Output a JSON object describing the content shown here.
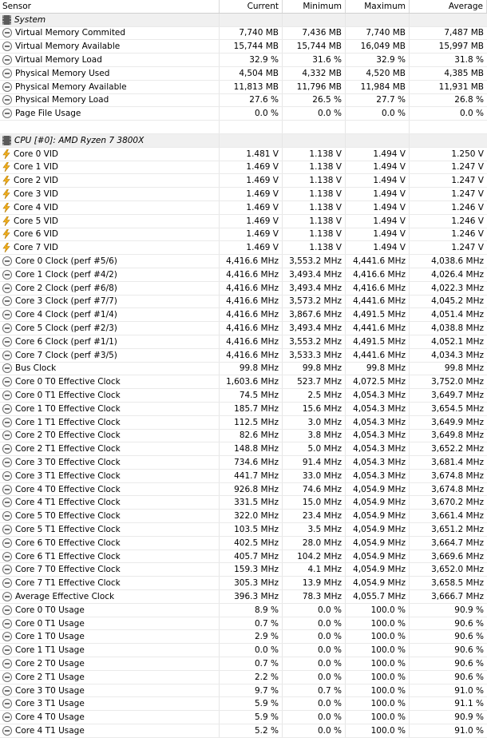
{
  "columns": {
    "sensor": "Sensor",
    "current": "Current",
    "minimum": "Minimum",
    "maximum": "Maximum",
    "average": "Average"
  },
  "rows": [
    {
      "type": "group",
      "icon": "chip-icon",
      "label": "System"
    },
    {
      "type": "sensor",
      "icon": "clock-icon",
      "label": "Virtual Memory Commited",
      "current": "7,740 MB",
      "minimum": "7,436 MB",
      "maximum": "7,740 MB",
      "average": "7,487 MB"
    },
    {
      "type": "sensor",
      "icon": "clock-icon",
      "label": "Virtual Memory Available",
      "current": "15,744 MB",
      "minimum": "15,744 MB",
      "maximum": "16,049 MB",
      "average": "15,997 MB"
    },
    {
      "type": "sensor",
      "icon": "clock-icon",
      "label": "Virtual Memory Load",
      "current": "32.9 %",
      "minimum": "31.6 %",
      "maximum": "32.9 %",
      "average": "31.8 %"
    },
    {
      "type": "sensor",
      "icon": "clock-icon",
      "label": "Physical Memory Used",
      "current": "4,504 MB",
      "minimum": "4,332 MB",
      "maximum": "4,520 MB",
      "average": "4,385 MB"
    },
    {
      "type": "sensor",
      "icon": "clock-icon",
      "label": "Physical Memory Available",
      "current": "11,813 MB",
      "minimum": "11,796 MB",
      "maximum": "11,984 MB",
      "average": "11,931 MB"
    },
    {
      "type": "sensor",
      "icon": "clock-icon",
      "label": "Physical Memory Load",
      "current": "27.6 %",
      "minimum": "26.5 %",
      "maximum": "27.7 %",
      "average": "26.8 %"
    },
    {
      "type": "sensor",
      "icon": "clock-icon",
      "label": "Page File Usage",
      "current": "0.0 %",
      "minimum": "0.0 %",
      "maximum": "0.0 %",
      "average": "0.0 %"
    },
    {
      "type": "blank"
    },
    {
      "type": "group",
      "icon": "chip-icon",
      "label": "CPU [#0]: AMD Ryzen 7 3800X"
    },
    {
      "type": "sensor",
      "icon": "voltage-icon",
      "label": "Core 0 VID",
      "current": "1.481 V",
      "minimum": "1.138 V",
      "maximum": "1.494 V",
      "average": "1.250 V"
    },
    {
      "type": "sensor",
      "icon": "voltage-icon",
      "label": "Core 1 VID",
      "current": "1.469 V",
      "minimum": "1.138 V",
      "maximum": "1.494 V",
      "average": "1.247 V"
    },
    {
      "type": "sensor",
      "icon": "voltage-icon",
      "label": "Core 2 VID",
      "current": "1.469 V",
      "minimum": "1.138 V",
      "maximum": "1.494 V",
      "average": "1.247 V"
    },
    {
      "type": "sensor",
      "icon": "voltage-icon",
      "label": "Core 3 VID",
      "current": "1.469 V",
      "minimum": "1.138 V",
      "maximum": "1.494 V",
      "average": "1.247 V"
    },
    {
      "type": "sensor",
      "icon": "voltage-icon",
      "label": "Core 4 VID",
      "current": "1.469 V",
      "minimum": "1.138 V",
      "maximum": "1.494 V",
      "average": "1.246 V"
    },
    {
      "type": "sensor",
      "icon": "voltage-icon",
      "label": "Core 5 VID",
      "current": "1.469 V",
      "minimum": "1.138 V",
      "maximum": "1.494 V",
      "average": "1.246 V"
    },
    {
      "type": "sensor",
      "icon": "voltage-icon",
      "label": "Core 6 VID",
      "current": "1.469 V",
      "minimum": "1.138 V",
      "maximum": "1.494 V",
      "average": "1.246 V"
    },
    {
      "type": "sensor",
      "icon": "voltage-icon",
      "label": "Core 7 VID",
      "current": "1.469 V",
      "minimum": "1.138 V",
      "maximum": "1.494 V",
      "average": "1.247 V"
    },
    {
      "type": "sensor",
      "icon": "clock-icon",
      "label": "Core 0 Clock (perf #5/6)",
      "current": "4,416.6 MHz",
      "minimum": "3,553.2 MHz",
      "maximum": "4,441.6 MHz",
      "average": "4,038.6 MHz"
    },
    {
      "type": "sensor",
      "icon": "clock-icon",
      "label": "Core 1 Clock (perf #4/2)",
      "current": "4,416.6 MHz",
      "minimum": "3,493.4 MHz",
      "maximum": "4,416.6 MHz",
      "average": "4,026.4 MHz"
    },
    {
      "type": "sensor",
      "icon": "clock-icon",
      "label": "Core 2 Clock (perf #6/8)",
      "current": "4,416.6 MHz",
      "minimum": "3,493.4 MHz",
      "maximum": "4,416.6 MHz",
      "average": "4,022.3 MHz"
    },
    {
      "type": "sensor",
      "icon": "clock-icon",
      "label": "Core 3 Clock (perf #7/7)",
      "current": "4,416.6 MHz",
      "minimum": "3,573.2 MHz",
      "maximum": "4,441.6 MHz",
      "average": "4,045.2 MHz"
    },
    {
      "type": "sensor",
      "icon": "clock-icon",
      "label": "Core 4 Clock (perf #1/4)",
      "current": "4,416.6 MHz",
      "minimum": "3,867.6 MHz",
      "maximum": "4,491.5 MHz",
      "average": "4,051.4 MHz"
    },
    {
      "type": "sensor",
      "icon": "clock-icon",
      "label": "Core 5 Clock (perf #2/3)",
      "current": "4,416.6 MHz",
      "minimum": "3,493.4 MHz",
      "maximum": "4,441.6 MHz",
      "average": "4,038.8 MHz"
    },
    {
      "type": "sensor",
      "icon": "clock-icon",
      "label": "Core 6 Clock (perf #1/1)",
      "current": "4,416.6 MHz",
      "minimum": "3,553.2 MHz",
      "maximum": "4,491.5 MHz",
      "average": "4,052.1 MHz"
    },
    {
      "type": "sensor",
      "icon": "clock-icon",
      "label": "Core 7 Clock (perf #3/5)",
      "current": "4,416.6 MHz",
      "minimum": "3,533.3 MHz",
      "maximum": "4,441.6 MHz",
      "average": "4,034.3 MHz"
    },
    {
      "type": "sensor",
      "icon": "clock-icon",
      "label": "Bus Clock",
      "current": "99.8 MHz",
      "minimum": "99.8 MHz",
      "maximum": "99.8 MHz",
      "average": "99.8 MHz"
    },
    {
      "type": "sensor",
      "icon": "clock-icon",
      "label": "Core 0 T0 Effective Clock",
      "current": "1,603.6 MHz",
      "minimum": "523.7 MHz",
      "maximum": "4,072.5 MHz",
      "average": "3,752.0 MHz"
    },
    {
      "type": "sensor",
      "icon": "clock-icon",
      "label": "Core 0 T1 Effective Clock",
      "current": "74.5 MHz",
      "minimum": "2.5 MHz",
      "maximum": "4,054.3 MHz",
      "average": "3,649.7 MHz"
    },
    {
      "type": "sensor",
      "icon": "clock-icon",
      "label": "Core 1 T0 Effective Clock",
      "current": "185.7 MHz",
      "minimum": "15.6 MHz",
      "maximum": "4,054.3 MHz",
      "average": "3,654.5 MHz"
    },
    {
      "type": "sensor",
      "icon": "clock-icon",
      "label": "Core 1 T1 Effective Clock",
      "current": "112.5 MHz",
      "minimum": "3.0 MHz",
      "maximum": "4,054.3 MHz",
      "average": "3,649.9 MHz"
    },
    {
      "type": "sensor",
      "icon": "clock-icon",
      "label": "Core 2 T0 Effective Clock",
      "current": "82.6 MHz",
      "minimum": "3.8 MHz",
      "maximum": "4,054.3 MHz",
      "average": "3,649.8 MHz"
    },
    {
      "type": "sensor",
      "icon": "clock-icon",
      "label": "Core 2 T1 Effective Clock",
      "current": "148.8 MHz",
      "minimum": "5.0 MHz",
      "maximum": "4,054.3 MHz",
      "average": "3,652.2 MHz"
    },
    {
      "type": "sensor",
      "icon": "clock-icon",
      "label": "Core 3 T0 Effective Clock",
      "current": "734.6 MHz",
      "minimum": "91.4 MHz",
      "maximum": "4,054.3 MHz",
      "average": "3,681.4 MHz"
    },
    {
      "type": "sensor",
      "icon": "clock-icon",
      "label": "Core 3 T1 Effective Clock",
      "current": "441.7 MHz",
      "minimum": "33.0 MHz",
      "maximum": "4,054.3 MHz",
      "average": "3,674.8 MHz"
    },
    {
      "type": "sensor",
      "icon": "clock-icon",
      "label": "Core 4 T0 Effective Clock",
      "current": "926.8 MHz",
      "minimum": "74.6 MHz",
      "maximum": "4,054.9 MHz",
      "average": "3,674.8 MHz"
    },
    {
      "type": "sensor",
      "icon": "clock-icon",
      "label": "Core 4 T1 Effective Clock",
      "current": "331.5 MHz",
      "minimum": "15.0 MHz",
      "maximum": "4,054.9 MHz",
      "average": "3,670.2 MHz"
    },
    {
      "type": "sensor",
      "icon": "clock-icon",
      "label": "Core 5 T0 Effective Clock",
      "current": "322.0 MHz",
      "minimum": "23.4 MHz",
      "maximum": "4,054.9 MHz",
      "average": "3,661.4 MHz"
    },
    {
      "type": "sensor",
      "icon": "clock-icon",
      "label": "Core 5 T1 Effective Clock",
      "current": "103.5 MHz",
      "minimum": "3.5 MHz",
      "maximum": "4,054.9 MHz",
      "average": "3,651.2 MHz"
    },
    {
      "type": "sensor",
      "icon": "clock-icon",
      "label": "Core 6 T0 Effective Clock",
      "current": "402.5 MHz",
      "minimum": "28.0 MHz",
      "maximum": "4,054.9 MHz",
      "average": "3,664.7 MHz"
    },
    {
      "type": "sensor",
      "icon": "clock-icon",
      "label": "Core 6 T1 Effective Clock",
      "current": "405.7 MHz",
      "minimum": "104.2 MHz",
      "maximum": "4,054.9 MHz",
      "average": "3,669.6 MHz"
    },
    {
      "type": "sensor",
      "icon": "clock-icon",
      "label": "Core 7 T0 Effective Clock",
      "current": "159.3 MHz",
      "minimum": "4.1 MHz",
      "maximum": "4,054.9 MHz",
      "average": "3,652.0 MHz"
    },
    {
      "type": "sensor",
      "icon": "clock-icon",
      "label": "Core 7 T1 Effective Clock",
      "current": "305.3 MHz",
      "minimum": "13.9 MHz",
      "maximum": "4,054.9 MHz",
      "average": "3,658.5 MHz"
    },
    {
      "type": "sensor",
      "icon": "clock-icon",
      "label": "Average Effective Clock",
      "current": "396.3 MHz",
      "minimum": "78.3 MHz",
      "maximum": "4,055.7 MHz",
      "average": "3,666.7 MHz"
    },
    {
      "type": "sensor",
      "icon": "clock-icon",
      "label": "Core 0 T0 Usage",
      "current": "8.9 %",
      "minimum": "0.0 %",
      "maximum": "100.0 %",
      "average": "90.9 %"
    },
    {
      "type": "sensor",
      "icon": "clock-icon",
      "label": "Core 0 T1 Usage",
      "current": "0.7 %",
      "minimum": "0.0 %",
      "maximum": "100.0 %",
      "average": "90.6 %"
    },
    {
      "type": "sensor",
      "icon": "clock-icon",
      "label": "Core 1 T0 Usage",
      "current": "2.9 %",
      "minimum": "0.0 %",
      "maximum": "100.0 %",
      "average": "90.6 %"
    },
    {
      "type": "sensor",
      "icon": "clock-icon",
      "label": "Core 1 T1 Usage",
      "current": "0.0 %",
      "minimum": "0.0 %",
      "maximum": "100.0 %",
      "average": "90.6 %"
    },
    {
      "type": "sensor",
      "icon": "clock-icon",
      "label": "Core 2 T0 Usage",
      "current": "0.7 %",
      "minimum": "0.0 %",
      "maximum": "100.0 %",
      "average": "90.6 %"
    },
    {
      "type": "sensor",
      "icon": "clock-icon",
      "label": "Core 2 T1 Usage",
      "current": "2.2 %",
      "minimum": "0.0 %",
      "maximum": "100.0 %",
      "average": "90.6 %"
    },
    {
      "type": "sensor",
      "icon": "clock-icon",
      "label": "Core 3 T0 Usage",
      "current": "9.7 %",
      "minimum": "0.7 %",
      "maximum": "100.0 %",
      "average": "91.0 %"
    },
    {
      "type": "sensor",
      "icon": "clock-icon",
      "label": "Core 3 T1 Usage",
      "current": "5.9 %",
      "minimum": "0.0 %",
      "maximum": "100.0 %",
      "average": "91.1 %"
    },
    {
      "type": "sensor",
      "icon": "clock-icon",
      "label": "Core 4 T0 Usage",
      "current": "5.9 %",
      "minimum": "0.0 %",
      "maximum": "100.0 %",
      "average": "90.9 %"
    },
    {
      "type": "sensor",
      "icon": "clock-icon",
      "label": "Core 4 T1 Usage",
      "current": "5.2 %",
      "minimum": "0.0 %",
      "maximum": "100.0 %",
      "average": "91.0 %"
    }
  ]
}
